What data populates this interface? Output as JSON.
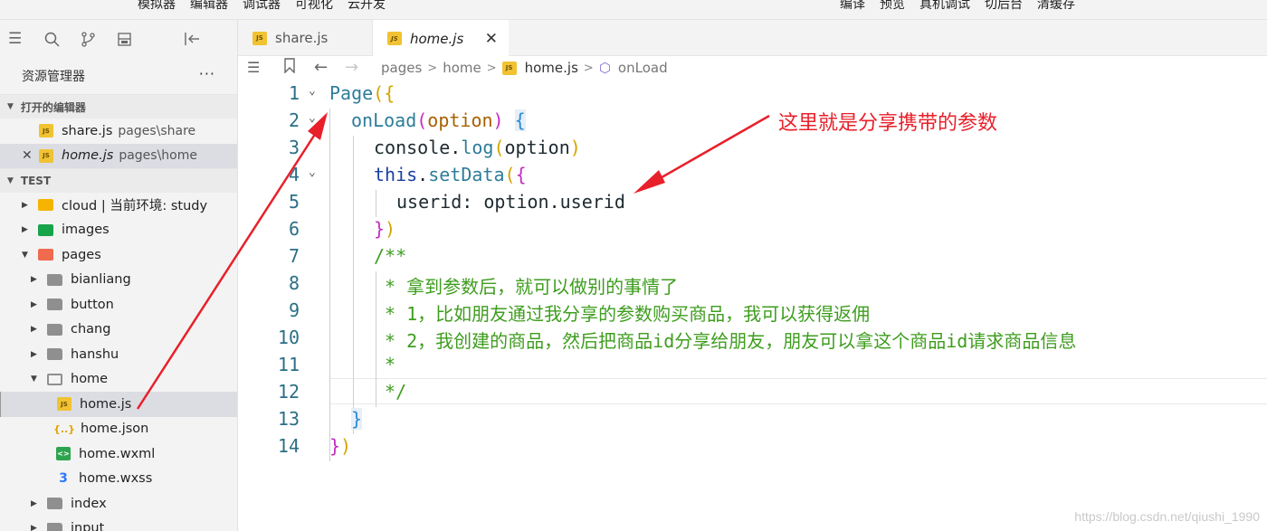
{
  "topbar": {
    "left_menu": [
      "模拟器",
      "编辑器",
      "调试器",
      "可视化",
      "云开发"
    ],
    "right_menu": [
      "编译",
      "预览",
      "真机调试",
      "切后台",
      "清缓存"
    ]
  },
  "sidebar": {
    "explorer_title": "资源管理器",
    "more_label": "···",
    "open_editors_label": "打开的编辑器",
    "open_editors": [
      {
        "name": "share.js",
        "path": "pages\\share"
      },
      {
        "name": "home.js",
        "path": "pages\\home"
      }
    ],
    "project_label": "TEST",
    "tree": {
      "cloud": "cloud | 当前环境: study",
      "images": "images",
      "pages": "pages",
      "bianliang": "bianliang",
      "button": "button",
      "chang": "chang",
      "hanshu": "hanshu",
      "home": "home",
      "home_js": "home.js",
      "home_json": "home.json",
      "home_wxml": "home.wxml",
      "home_wxss": "home.wxss",
      "index": "index",
      "input": "input"
    }
  },
  "tabs": [
    {
      "label": "share.js",
      "active": false
    },
    {
      "label": "home.js",
      "active": true
    }
  ],
  "breadcrumb": [
    "pages",
    "home",
    "home.js",
    "onLoad"
  ],
  "line_numbers": [
    "1",
    "2",
    "3",
    "4",
    "5",
    "6",
    "7",
    "8",
    "9",
    "10",
    "11",
    "12",
    "13",
    "14"
  ],
  "code": {
    "l1_a": "Page",
    "l1_b": "({",
    "l2_a": "onLoad",
    "l2_b": "(",
    "l2_c": "option",
    "l2_d": ") ",
    "l2_e": "{",
    "l3_a": "console.",
    "l3_b": "log",
    "l3_c": "(",
    "l3_d": "option",
    "l3_e": ")",
    "l4_a": "this",
    "l4_b": ".",
    "l4_c": "setData",
    "l4_d": "(",
    "l4_e": "{",
    "l5_a": "userid",
    "l5_b": ": option.userid",
    "l6_a": "}",
    "l6_b": ")",
    "l7": "/**",
    "l8": " * 拿到参数后，就可以做别的事情了",
    "l9": " * 1，比如朋友通过我分享的参数购买商品，我可以获得返佣",
    "l10": " * 2，我创建的商品，然后把商品id分享给朋友，朋友可以拿这个商品id请求商品信息",
    "l11": " *",
    "l12": " */",
    "l13": "}",
    "l14_a": "}",
    "l14_b": ")"
  },
  "annotation": "这里就是分享携带的参数",
  "watermark": "https://blog.csdn.net/qiushi_1990",
  "colors": {
    "annotation": "#e8202a",
    "comment": "#3e9d1e",
    "function": "#2e7d9a",
    "keyword": "#1a3fa0"
  }
}
